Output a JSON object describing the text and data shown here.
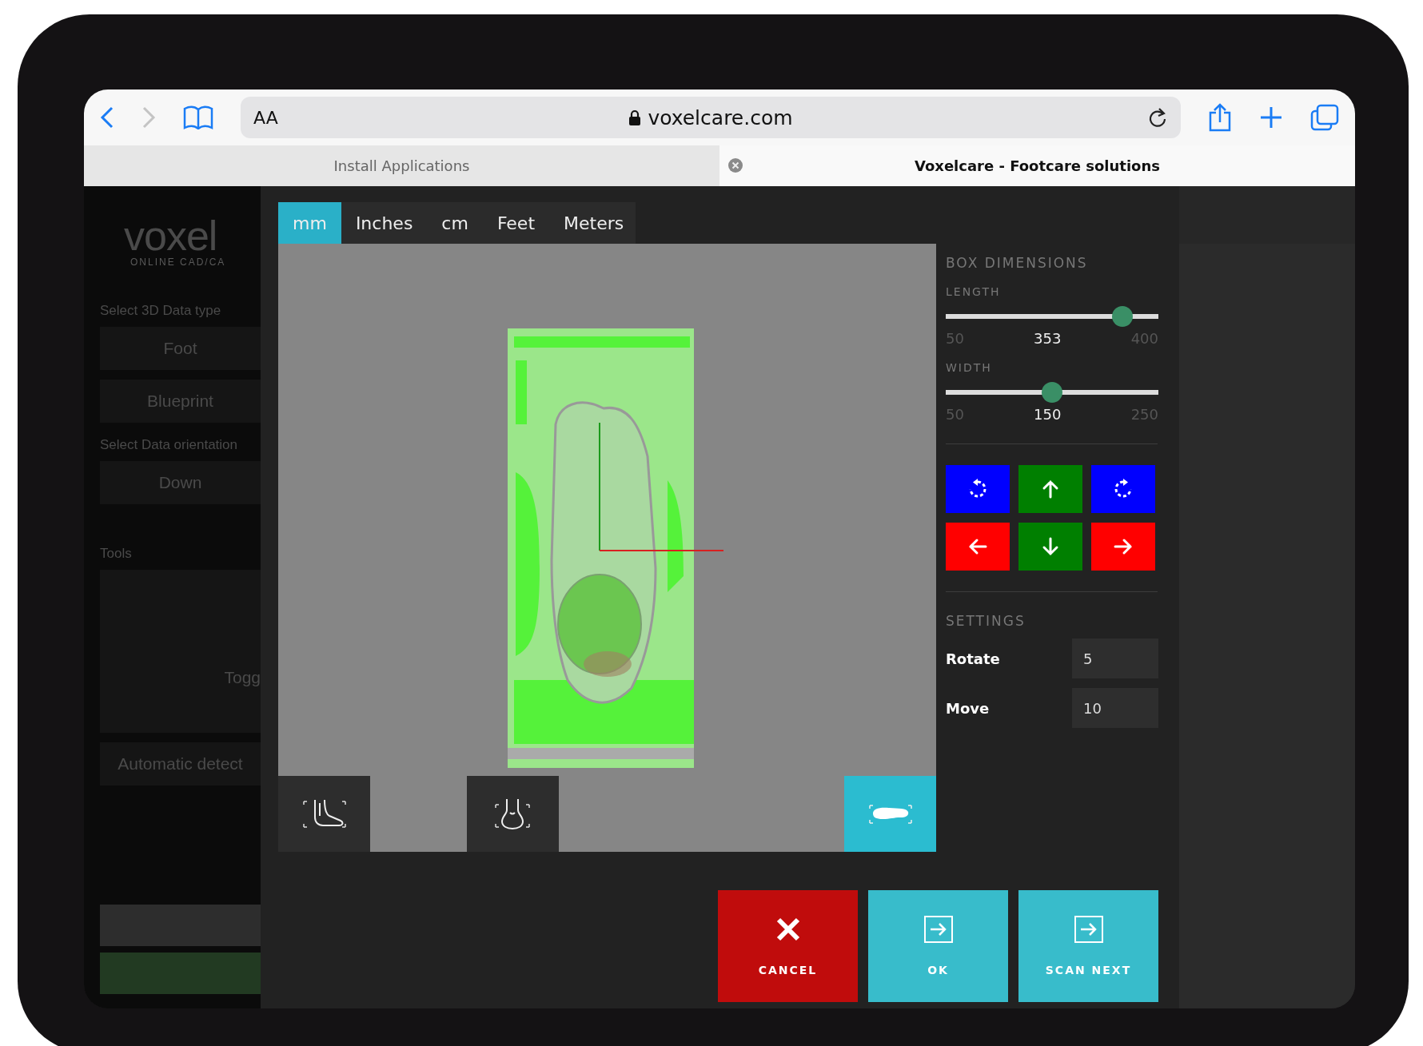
{
  "browser": {
    "text_size": "AA",
    "address": "voxelcare.com",
    "tabs": [
      {
        "title": "Install Applications",
        "selected": false
      },
      {
        "title": "Voxelcare - Footcare solutions",
        "selected": true
      }
    ]
  },
  "sidebar": {
    "logo": "voxel",
    "tagline": "ONLINE CAD/CA",
    "items": [
      {
        "kind": "label",
        "text": "Select 3D Data type"
      },
      {
        "kind": "button",
        "text": "Foot"
      },
      {
        "kind": "button",
        "text": "Blueprint"
      },
      {
        "kind": "label",
        "text": "Select Data orientation"
      },
      {
        "kind": "button",
        "text": "Down"
      },
      {
        "kind": "label",
        "text": "Tools"
      },
      {
        "kind": "button-end",
        "text": "Togg"
      },
      {
        "kind": "button",
        "text": "Automatic detect"
      }
    ]
  },
  "units": [
    {
      "label": "mm",
      "selected": true
    },
    {
      "label": "Inches",
      "selected": false
    },
    {
      "label": "cm",
      "selected": false
    },
    {
      "label": "Feet",
      "selected": false
    },
    {
      "label": "Meters",
      "selected": false
    }
  ],
  "views": [
    {
      "kind": "side",
      "selected": false
    },
    {
      "kind": "front",
      "selected": false
    },
    {
      "kind": "top",
      "selected": true
    }
  ],
  "box_dimensions": {
    "title": "BOX DIMENSIONS",
    "sliders": [
      {
        "label": "LENGTH",
        "min": "50",
        "value": "353",
        "max": "400",
        "level": 0.866
      },
      {
        "label": "WIDTH",
        "min": "50",
        "value": "150",
        "max": "250",
        "level": 0.5
      }
    ]
  },
  "move_buttons": [
    {
      "kind": "rotate-left",
      "color": "#0000ff"
    },
    {
      "kind": "up",
      "color": "#007f00"
    },
    {
      "kind": "rotate-right",
      "color": "#0000ff"
    },
    {
      "kind": "left",
      "color": "#ff0000"
    },
    {
      "kind": "down",
      "color": "#007f00"
    },
    {
      "kind": "right",
      "color": "#ff0000"
    }
  ],
  "settings": {
    "title": "SETTINGS",
    "fields": [
      {
        "label": "Rotate",
        "value": "5"
      },
      {
        "label": "Move",
        "value": "10"
      }
    ]
  },
  "actions": [
    {
      "kind": "cancel",
      "label": "CANCEL"
    },
    {
      "kind": "ok",
      "label": "OK"
    },
    {
      "kind": "next",
      "label": "SCAN NEXT"
    }
  ]
}
